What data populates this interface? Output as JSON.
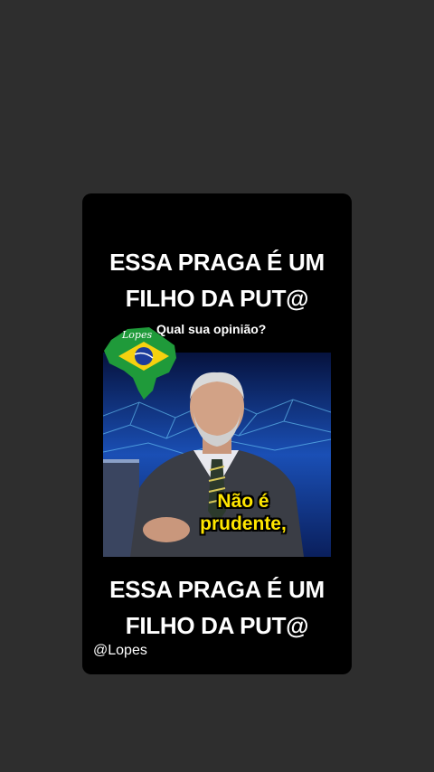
{
  "post": {
    "headline_top": [
      "ESSA PRAGA É UM",
      "FILHO DA PUT@"
    ],
    "subtitle": "Qual sua opinião?",
    "logo_text": "Lopes",
    "caption": [
      "Não é",
      "prudente,"
    ],
    "headline_bottom": [
      "ESSA PRAGA É UM",
      "FILHO DA PUT@"
    ],
    "handle": "@Lopes"
  },
  "colors": {
    "page_bg": "#2e2e2e",
    "card_bg": "#000000",
    "caption_yellow": "#ffe600",
    "studio_blue": "#0a1f5c"
  }
}
